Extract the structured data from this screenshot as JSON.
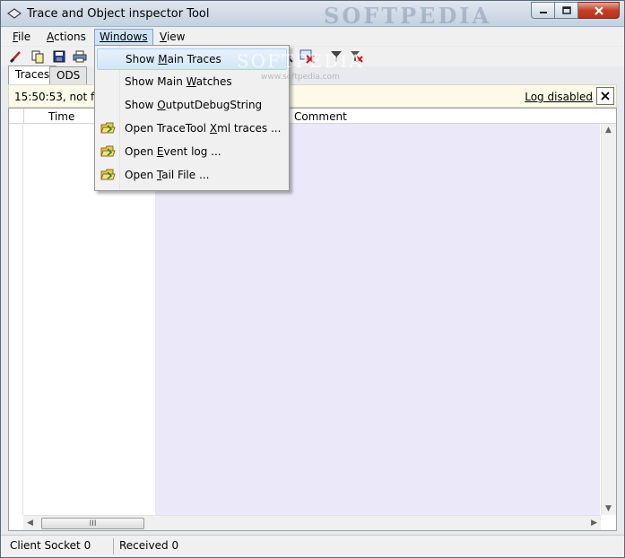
{
  "window": {
    "title": "Trace and Object inspector Tool",
    "watermark": "SOFTPEDIA"
  },
  "menubar": {
    "items": [
      {
        "label": "File",
        "accel": "F",
        "rest": "ile"
      },
      {
        "label": "Actions",
        "accel": "A",
        "rest": "ctions"
      },
      {
        "label": "Windows",
        "accel": "W",
        "rest": "indows"
      },
      {
        "label": "View",
        "accel": "V",
        "rest": "iew"
      }
    ]
  },
  "tabs": [
    {
      "label": "Traces"
    },
    {
      "label": "ODS"
    }
  ],
  "infobar": {
    "text": "15:50:53, not filtere",
    "log_link": "Log disabled",
    "close": "✕"
  },
  "grid": {
    "columns": [
      "Time",
      "Comment"
    ],
    "hscroll_grip": "III"
  },
  "statusbar": {
    "client_socket_label": "Client Socket",
    "client_socket_value": "0",
    "received_label": "Received",
    "received_value": "0"
  },
  "windows_menu": {
    "items": [
      {
        "pre": "Show ",
        "accel": "M",
        "post": "ain Traces"
      },
      {
        "pre": "Show Main ",
        "accel": "W",
        "post": "atches"
      },
      {
        "pre": "Show ",
        "accel": "O",
        "post": "utputDebugString"
      },
      {
        "pre": "Open TraceTool ",
        "accel": "X",
        "post": "ml traces ..."
      },
      {
        "pre": "Open ",
        "accel": "E",
        "post": "vent log ..."
      },
      {
        "pre": "Open ",
        "accel": "T",
        "post": "ail File ..."
      }
    ],
    "watermark": "SOFTPEDIA",
    "watermark_sub": "www.softpedia.com"
  },
  "colors": {
    "accent": "#cde4f7",
    "trace_pane": "#ebe8f9",
    "infobar": "#fdfbe8"
  }
}
